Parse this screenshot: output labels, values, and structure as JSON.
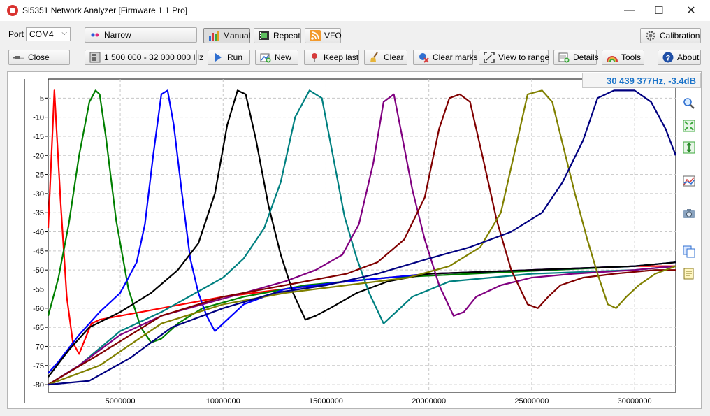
{
  "window": {
    "title": "Si5351 Network Analyzer [Firmware 1.1 Pro]",
    "minimize": "—",
    "maximize": "☐",
    "close": "✕"
  },
  "toolbar": {
    "port_label": "Port",
    "port_value": "COM4",
    "mode_value": "Narrow",
    "manual": "Manual",
    "repeat": "Repeat",
    "vfo": "VFO",
    "calibration": "Calibration",
    "close": "Close",
    "range": "1 500 000 - 32 000 000 Hz",
    "run": "Run",
    "new": "New",
    "keep_last": "Keep last",
    "clear": "Clear",
    "clear_marks": "Clear marks",
    "view_to_range": "View to range",
    "details": "Details",
    "tools": "Tools",
    "about": "About"
  },
  "readout": "30 439 377Hz, -3.4dB",
  "chart_data": {
    "type": "line",
    "xlim": [
      1500000,
      32000000
    ],
    "ylim": [
      -82,
      0
    ],
    "x_ticks": [
      5000000,
      10000000,
      15000000,
      20000000,
      25000000,
      30000000
    ],
    "x_tick_labels": [
      "5000000",
      "10000000",
      "15000000",
      "20000000",
      "25000000",
      "30000000"
    ],
    "y_ticks": [
      -5,
      -10,
      -15,
      -20,
      -25,
      -30,
      -35,
      -40,
      -45,
      -50,
      -55,
      -60,
      -65,
      -70,
      -75,
      -80
    ],
    "y_tick_labels": [
      "-5",
      "-10",
      "-15",
      "-20",
      "-25",
      "-30",
      "-35",
      "-40",
      "-45",
      "-50",
      "-55",
      "-60",
      "-65",
      "-70",
      "-75",
      "-80"
    ],
    "grid": true,
    "series": [
      {
        "color": "#ff0000",
        "x": [
          1500000,
          1800000,
          2100000,
          2400000,
          2700000,
          3000000,
          3300000,
          3600000,
          4000000,
          5000000,
          6000000,
          8000000,
          10000000,
          13000000,
          16000000,
          20000000,
          25000000,
          30000000,
          32000000
        ],
        "y": [
          -39,
          -3,
          -32,
          -57,
          -69,
          -72,
          -68,
          -64,
          -63,
          -62,
          -61,
          -59,
          -57,
          -55,
          -53,
          -51,
          -50,
          -49,
          -49
        ]
      },
      {
        "color": "#007f00",
        "x": [
          1500000,
          2000000,
          2500000,
          3000000,
          3500000,
          3800000,
          4000000,
          4300000,
          4800000,
          5400000,
          6000000,
          6500000,
          7000000,
          7800000,
          9000000,
          11000000,
          14000000,
          18000000,
          22000000,
          26000000,
          30000000,
          32000000
        ],
        "y": [
          -62,
          -52,
          -38,
          -20,
          -6,
          -3,
          -4,
          -15,
          -37,
          -55,
          -65,
          -69,
          -68,
          -64,
          -60,
          -57,
          -54,
          -52,
          -51,
          -50,
          -49,
          -48
        ]
      },
      {
        "color": "#0000ff",
        "x": [
          1500000,
          2000000,
          3000000,
          4000000,
          5000000,
          5800000,
          6200000,
          6600000,
          7000000,
          7300000,
          7600000,
          8000000,
          8400000,
          8800000,
          9200000,
          9600000,
          10000000,
          11000000,
          13000000,
          16000000,
          20000000,
          25000000,
          30000000,
          32000000
        ],
        "y": [
          -77,
          -74,
          -67,
          -61,
          -56,
          -48,
          -38,
          -20,
          -4,
          -3,
          -12,
          -30,
          -47,
          -56,
          -62,
          -66,
          -64,
          -59,
          -55,
          -53,
          -51,
          -50,
          -49,
          -48
        ]
      },
      {
        "color": "#000000",
        "x": [
          1500000,
          2500000,
          3500000,
          5000000,
          6500000,
          7800000,
          8800000,
          9600000,
          10200000,
          10700000,
          11100000,
          11600000,
          12200000,
          12800000,
          13400000,
          14000000,
          14500000,
          15200000,
          16500000,
          18000000,
          20000000,
          25000000,
          30000000,
          32000000
        ],
        "y": [
          -78,
          -71,
          -65,
          -61,
          -56,
          -50,
          -43,
          -30,
          -12,
          -3,
          -4,
          -16,
          -33,
          -46,
          -56,
          -63,
          -62,
          -60,
          -56,
          -53,
          -51,
          -50,
          -49,
          -48
        ]
      },
      {
        "color": "#008080",
        "x": [
          1500000,
          3000000,
          5000000,
          7000000,
          8000000,
          9000000,
          10000000,
          11000000,
          12000000,
          12800000,
          13500000,
          14200000,
          14800000,
          15300000,
          15900000,
          16500000,
          17100000,
          17800000,
          18400000,
          19200000,
          21000000,
          25000000,
          30000000,
          32000000
        ],
        "y": [
          -80,
          -75,
          -66,
          -61,
          -58,
          -55,
          -52,
          -47,
          -39,
          -27,
          -10,
          -3,
          -5,
          -19,
          -36,
          -47,
          -56,
          -64,
          -61,
          -57,
          -53,
          -51,
          -50,
          -49
        ]
      },
      {
        "color": "#800080",
        "x": [
          1500000,
          3000000,
          5000000,
          7000000,
          9000000,
          11000000,
          13000000,
          14500000,
          15800000,
          16600000,
          17300000,
          17800000,
          18300000,
          18700000,
          19200000,
          19800000,
          20500000,
          21200000,
          21700000,
          22300000,
          23500000,
          25000000,
          27000000,
          30000000,
          32000000
        ],
        "y": [
          -80,
          -75,
          -67,
          -62,
          -59,
          -56,
          -53,
          -50,
          -46,
          -38,
          -22,
          -6,
          -4,
          -15,
          -29,
          -42,
          -54,
          -62,
          -61,
          -57,
          -54,
          -52,
          -51,
          -50,
          -49
        ]
      },
      {
        "color": "#800000",
        "x": [
          1500000,
          4000000,
          7000000,
          10000000,
          13000000,
          16000000,
          17500000,
          18800000,
          19800000,
          20500000,
          21000000,
          21500000,
          22000000,
          22600000,
          23300000,
          24000000,
          24800000,
          25300000,
          25800000,
          26400000,
          27500000,
          29000000,
          31000000,
          32000000
        ],
        "y": [
          -80,
          -72,
          -62,
          -57,
          -54,
          -51,
          -48,
          -42,
          -31,
          -13,
          -5,
          -4,
          -6,
          -20,
          -37,
          -50,
          -59,
          -60,
          -57,
          -54,
          -52,
          -51,
          -50,
          -50
        ]
      },
      {
        "color": "#808000",
        "x": [
          1500000,
          4000000,
          7000000,
          10000000,
          13000000,
          16000000,
          19000000,
          21000000,
          22500000,
          23500000,
          24300000,
          24800000,
          25500000,
          26000000,
          26500000,
          27100000,
          27700000,
          28200000,
          28700000,
          29100000,
          29600000,
          30200000,
          31000000,
          32000000
        ],
        "y": [
          -80,
          -75,
          -64,
          -59,
          -56,
          -54,
          -52,
          -49,
          -44,
          -35,
          -16,
          -4,
          -3,
          -6,
          -17,
          -30,
          -42,
          -51,
          -59,
          -60,
          -57,
          -54,
          -51,
          -49
        ]
      },
      {
        "color": "#000080",
        "x": [
          1500000,
          3500000,
          5500000,
          7500000,
          10000000,
          12500000,
          15000000,
          17500000,
          20000000,
          22000000,
          24000000,
          25500000,
          26500000,
          27500000,
          28200000,
          29000000,
          30000000,
          30800000,
          31500000,
          32000000
        ],
        "y": [
          -80,
          -79,
          -73,
          -65,
          -60,
          -56,
          -54,
          -51,
          -47,
          -44,
          -40,
          -35,
          -27,
          -16,
          -5,
          -3,
          -3,
          -6,
          -13,
          -20
        ]
      }
    ]
  }
}
